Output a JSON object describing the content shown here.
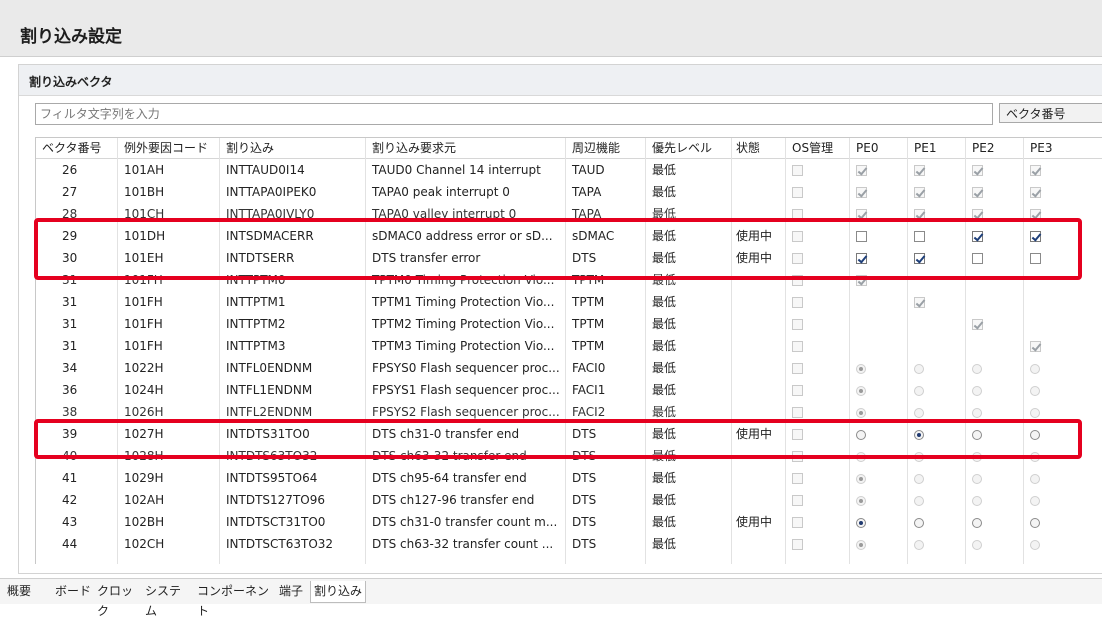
{
  "title": "割り込み設定",
  "section": "割り込みベクタ",
  "filter": {
    "placeholder": "フィルタ文字列を入力"
  },
  "combo": {
    "value": "ベクタ番号"
  },
  "columns": [
    "ベクタ番号",
    "例外要因コード",
    "割り込み",
    "割り込み要求元",
    "周辺機能",
    "優先レベル",
    "状態",
    "OS管理",
    "PE0",
    "PE1",
    "PE2",
    "PE3"
  ],
  "rows": [
    {
      "vec": "26",
      "code": "101AH",
      "name": "INTTAUD0I14",
      "src": "TAUD0 Channel 14 interrupt",
      "periph": "TAUD",
      "prio": "最低",
      "state": "",
      "pe_type": "chk",
      "pe": [
        "on",
        "on",
        "on",
        "on"
      ],
      "active": false
    },
    {
      "vec": "27",
      "code": "101BH",
      "name": "INTTAPA0IPEK0",
      "src": "TAPA0 peak interrupt 0",
      "periph": "TAPA",
      "prio": "最低",
      "state": "",
      "pe_type": "chk",
      "pe": [
        "on",
        "on",
        "on",
        "on"
      ],
      "active": false
    },
    {
      "vec": "28",
      "code": "101CH",
      "name": "INTTAPA0IVLY0",
      "src": "TAPA0 valley interrupt 0",
      "periph": "TAPA",
      "prio": "最低",
      "state": "",
      "pe_type": "chk",
      "pe": [
        "on",
        "on",
        "on",
        "on"
      ],
      "active": false,
      "cut": true
    },
    {
      "vec": "29",
      "code": "101DH",
      "name": "INTSDMACERR",
      "src": "sDMAC0 address error or sD...",
      "periph": "sDMAC",
      "prio": "最低",
      "state": "使用中",
      "pe_type": "chk",
      "pe": [
        "off",
        "off",
        "on",
        "on"
      ],
      "active": true
    },
    {
      "vec": "30",
      "code": "101EH",
      "name": "INTDTSERR",
      "src": "DTS transfer error",
      "periph": "DTS",
      "prio": "最低",
      "state": "使用中",
      "pe_type": "chk",
      "pe": [
        "on",
        "on",
        "off",
        "off"
      ],
      "active": true
    },
    {
      "vec": "31",
      "code": "101FH",
      "name": "INTTPTM0",
      "src": "TPTM0 Timing Protection Vio...",
      "periph": "TPTM",
      "prio": "最低",
      "state": "",
      "pe_type": "chk",
      "pe": [
        "on",
        "",
        "",
        ""
      ],
      "active": false,
      "cut": true
    },
    {
      "vec": "31",
      "code": "101FH",
      "name": "INTTPTM1",
      "src": "TPTM1 Timing Protection Vio...",
      "periph": "TPTM",
      "prio": "最低",
      "state": "",
      "pe_type": "chk",
      "pe": [
        "",
        "on",
        "",
        ""
      ],
      "active": false
    },
    {
      "vec": "31",
      "code": "101FH",
      "name": "INTTPTM2",
      "src": "TPTM2 Timing Protection Vio...",
      "periph": "TPTM",
      "prio": "最低",
      "state": "",
      "pe_type": "chk",
      "pe": [
        "",
        "",
        "on",
        ""
      ],
      "active": false
    },
    {
      "vec": "31",
      "code": "101FH",
      "name": "INTTPTM3",
      "src": "TPTM3 Timing Protection Vio...",
      "periph": "TPTM",
      "prio": "最低",
      "state": "",
      "pe_type": "chk",
      "pe": [
        "",
        "",
        "",
        "on"
      ],
      "active": false
    },
    {
      "vec": "34",
      "code": "1022H",
      "name": "INTFL0ENDNM",
      "src": "FPSYS0 Flash sequencer proc...",
      "periph": "FACI0",
      "prio": "最低",
      "state": "",
      "pe_type": "rad",
      "pe": [
        "sel",
        "off",
        "off",
        "off"
      ],
      "active": false
    },
    {
      "vec": "36",
      "code": "1024H",
      "name": "INTFL1ENDNM",
      "src": "FPSYS1 Flash sequencer proc...",
      "periph": "FACI1",
      "prio": "最低",
      "state": "",
      "pe_type": "rad",
      "pe": [
        "sel",
        "off",
        "off",
        "off"
      ],
      "active": false
    },
    {
      "vec": "38",
      "code": "1026H",
      "name": "INTFL2ENDNM",
      "src": "FPSYS2 Flash sequencer proc...",
      "periph": "FACI2",
      "prio": "最低",
      "state": "",
      "pe_type": "rad",
      "pe": [
        "sel",
        "off",
        "off",
        "off"
      ],
      "active": false,
      "cut": true
    },
    {
      "vec": "39",
      "code": "1027H",
      "name": "INTDTS31TO0",
      "src": "DTS ch31-0 transfer end",
      "periph": "DTS",
      "prio": "最低",
      "state": "使用中",
      "pe_type": "rad",
      "pe": [
        "off",
        "sel",
        "off",
        "off"
      ],
      "active": true
    },
    {
      "vec": "40",
      "code": "1028H",
      "name": "INTDTS63TO32",
      "src": "DTS ch63-32 transfer end",
      "periph": "DTS",
      "prio": "最低",
      "state": "",
      "pe_type": "rad",
      "pe": [
        "sel",
        "off",
        "off",
        "off"
      ],
      "active": false,
      "cut": true
    },
    {
      "vec": "41",
      "code": "1029H",
      "name": "INTDTS95TO64",
      "src": "DTS ch95-64 transfer end",
      "periph": "DTS",
      "prio": "最低",
      "state": "",
      "pe_type": "rad",
      "pe": [
        "sel",
        "off",
        "off",
        "off"
      ],
      "active": false
    },
    {
      "vec": "42",
      "code": "102AH",
      "name": "INTDTS127TO96",
      "src": "DTS ch127-96 transfer end",
      "periph": "DTS",
      "prio": "最低",
      "state": "",
      "pe_type": "rad",
      "pe": [
        "sel",
        "off",
        "off",
        "off"
      ],
      "active": false
    },
    {
      "vec": "43",
      "code": "102BH",
      "name": "INTDTSCT31TO0",
      "src": "DTS ch31-0 transfer count m...",
      "periph": "DTS",
      "prio": "最低",
      "state": "使用中",
      "pe_type": "rad",
      "pe": [
        "sel",
        "off",
        "off",
        "off"
      ],
      "active": true
    },
    {
      "vec": "44",
      "code": "102CH",
      "name": "INTDTSCT63TO32",
      "src": "DTS ch63-32 transfer count ...",
      "periph": "DTS",
      "prio": "最低",
      "state": "",
      "pe_type": "rad",
      "pe": [
        "sel",
        "off",
        "off",
        "off"
      ],
      "active": false
    }
  ],
  "tabs": [
    "概要",
    "ボード",
    "クロック",
    "システム",
    "コンポーネント",
    "端子",
    "割り込み"
  ],
  "active_tab": "割り込み",
  "highlight_color": "#e5001f"
}
